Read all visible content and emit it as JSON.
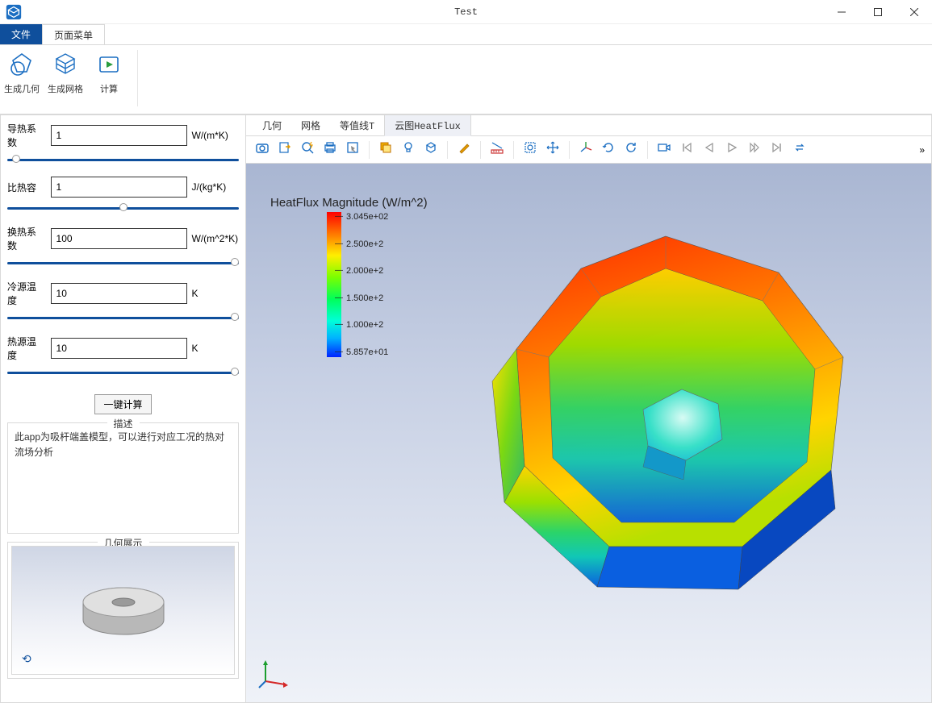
{
  "window": {
    "title": "Test"
  },
  "menu": {
    "file": "文件",
    "page_menu": "页面菜单"
  },
  "ribbon": {
    "gen_geometry": "生成几何",
    "gen_mesh": "生成网格",
    "compute": "计算"
  },
  "params": {
    "thermal_conductivity": {
      "label": "导热系数",
      "value": "1",
      "unit": "W/(m*K)"
    },
    "specific_heat": {
      "label": "比热容",
      "value": "1",
      "unit": "J/(kg*K)"
    },
    "heat_transfer_coeff": {
      "label": "换热系数",
      "value": "100",
      "unit": "W/(m^2*K)"
    },
    "cold_source_temp": {
      "label": "冷源温度",
      "value": "10",
      "unit": "K"
    },
    "hot_source_temp": {
      "label": "热源温度",
      "value": "10",
      "unit": "K"
    },
    "compute_btn": "一键计算"
  },
  "description": {
    "legend": "描述",
    "text": "此app为吸杆端盖模型，可以进行对应工况的热对流场分析"
  },
  "geom_preview": {
    "legend": "几何展示"
  },
  "view_tabs": {
    "geometry": "几何",
    "mesh": "网格",
    "contour_t": "等值线T",
    "cloud_heatflux": "云图HeatFlux"
  },
  "viewport": {
    "legend_title": "HeatFlux Magnitude (W/m^2)",
    "ticks": [
      "3.045e+02",
      "2.500e+2",
      "2.000e+2",
      "1.500e+2",
      "1.000e+2",
      "5.857e+01"
    ]
  },
  "toolbar_overflow": "»",
  "chart_data": {
    "type": "heatmap",
    "title": "HeatFlux Magnitude (W/m^2)",
    "colorbar_range": [
      58.57,
      304.5
    ],
    "ticks": [
      304.5,
      250,
      200,
      150,
      100,
      58.57
    ],
    "tick_labels": [
      "3.045e+02",
      "2.500e+2",
      "2.000e+2",
      "1.500e+2",
      "1.000e+2",
      "5.857e+01"
    ]
  }
}
